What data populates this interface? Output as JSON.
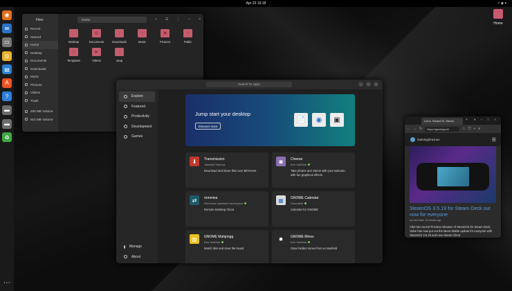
{
  "topbar": {
    "datetime": "Apr 23 16:18",
    "system_tray": "⚡ ◉ ▾"
  },
  "dock": {
    "items": [
      {
        "name": "firefox",
        "glyph": "◉",
        "color": "#e36f1e"
      },
      {
        "name": "thunderbird",
        "glyph": "✉",
        "color": "#2a72c8"
      },
      {
        "name": "files",
        "glyph": "▭",
        "color": "#777777"
      },
      {
        "name": "rhythmbox",
        "glyph": "◎",
        "color": "#e8b22a"
      },
      {
        "name": "libreoffice-writer",
        "glyph": "▤",
        "color": "#2a7fd0"
      },
      {
        "name": "app-center",
        "glyph": "A",
        "color": "#e95420"
      },
      {
        "name": "help",
        "glyph": "?",
        "color": "#2f7fd6"
      },
      {
        "name": "drive-1",
        "glyph": "▬",
        "color": "#6c6c6c"
      },
      {
        "name": "drive-2",
        "glyph": "▬",
        "color": "#6c6c6c"
      },
      {
        "name": "trash",
        "glyph": "♻",
        "color": "#3fa845"
      }
    ],
    "apps_grid": "⋯"
  },
  "desktop": {
    "home_label": "Home"
  },
  "files_window": {
    "title": "Files",
    "path": "Home",
    "sidebar": [
      {
        "label": "Recent"
      },
      {
        "label": "Starred"
      },
      {
        "label": "Home",
        "active": true
      },
      {
        "label": "Desktop"
      },
      {
        "label": "Documents"
      },
      {
        "label": "Downloads"
      },
      {
        "label": "Music"
      },
      {
        "label": "Pictures"
      },
      {
        "label": "Videos"
      },
      {
        "label": "Trash"
      },
      {
        "label": "480 MB Volume"
      },
      {
        "label": "910 MB Volume"
      }
    ],
    "folders": [
      {
        "label": "Desktop",
        "glyph": ""
      },
      {
        "label": "Documents",
        "glyph": "▤"
      },
      {
        "label": "Downloads",
        "glyph": "↓"
      },
      {
        "label": "Music",
        "glyph": "♪"
      },
      {
        "label": "Pictures",
        "glyph": "▣"
      },
      {
        "label": "Public",
        "glyph": "<"
      },
      {
        "label": "Templates",
        "glyph": "▢"
      },
      {
        "label": "Videos",
        "glyph": "▶"
      },
      {
        "label": "snap",
        "glyph": ""
      }
    ]
  },
  "software": {
    "search_placeholder": "Search for apps",
    "nav": [
      {
        "label": "Explore",
        "active": true
      },
      {
        "label": "Featured"
      },
      {
        "label": "Productivity"
      },
      {
        "label": "Development"
      },
      {
        "label": "Games"
      }
    ],
    "manage": "Manage",
    "about": "About",
    "banner": {
      "title": "Jump start your desktop",
      "button": "Discover more"
    },
    "cards": [
      {
        "name": "Transmission",
        "dev": "Jasmeet Sharma",
        "verified": false,
        "desc": "Download and share files over BitTorrent",
        "icon_color": "#c0392b",
        "glyph": "⬇"
      },
      {
        "name": "Cheese",
        "dev": "Ken VanDine",
        "verified": true,
        "desc": "Take photos and videos with your webcam, with fun graphical effects",
        "icon_color": "#8a6fb0",
        "glyph": "◙"
      },
      {
        "name": "remmina",
        "dev": "Remmina Upstream developers",
        "verified": true,
        "desc": "Remote Desktop Client",
        "icon_color": "#1d5a6a",
        "glyph": "⇄"
      },
      {
        "name": "GNOME Calendar",
        "dev": "Canonical",
        "verified": true,
        "desc": "Calendar for GNOME",
        "icon_color": "#dcdcdc",
        "glyph": "▦"
      },
      {
        "name": "GNOME Mahjongg",
        "dev": "Ken VanDine",
        "verified": true,
        "desc": "Match tiles and clear the board",
        "icon_color": "#e8c020",
        "glyph": "▥"
      },
      {
        "name": "GNOME Mines",
        "dev": "Ken VanDine",
        "verified": true,
        "desc": "Clear hidden mines from a minefield",
        "icon_color": "#2a2a2a",
        "glyph": "✹"
      }
    ]
  },
  "browser": {
    "tab_title": "Linux, SteamOS, Steam",
    "url": "https://gamingonli",
    "site_name": "GamingOnLinux",
    "article_title": "SteamOS 3.5.19 for Steam Deck out now for everyone",
    "article_meta": "by Liam Dawe, 29 minutes ago",
    "article_body": "After two recent Preview releases of SteamOS for Steam Deck, Valve has now put out the latest Stable update for everyone with SteamOS 3.5.19 and new Steam Client"
  }
}
